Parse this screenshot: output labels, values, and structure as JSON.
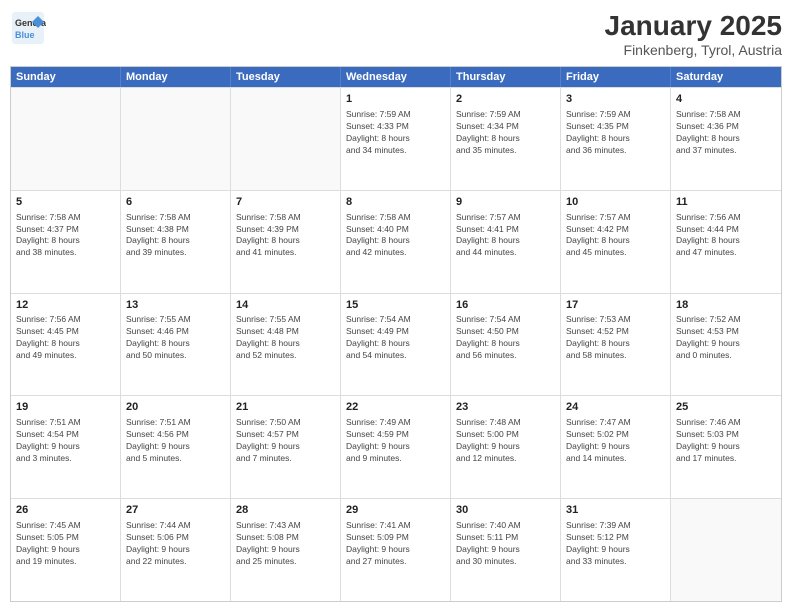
{
  "header": {
    "logo_line1": "General",
    "logo_line2": "Blue",
    "title": "January 2025",
    "subtitle": "Finkenberg, Tyrol, Austria"
  },
  "weekdays": [
    "Sunday",
    "Monday",
    "Tuesday",
    "Wednesday",
    "Thursday",
    "Friday",
    "Saturday"
  ],
  "weeks": [
    [
      {
        "day": "",
        "text": ""
      },
      {
        "day": "",
        "text": ""
      },
      {
        "day": "",
        "text": ""
      },
      {
        "day": "1",
        "text": "Sunrise: 7:59 AM\nSunset: 4:33 PM\nDaylight: 8 hours\nand 34 minutes."
      },
      {
        "day": "2",
        "text": "Sunrise: 7:59 AM\nSunset: 4:34 PM\nDaylight: 8 hours\nand 35 minutes."
      },
      {
        "day": "3",
        "text": "Sunrise: 7:59 AM\nSunset: 4:35 PM\nDaylight: 8 hours\nand 36 minutes."
      },
      {
        "day": "4",
        "text": "Sunrise: 7:58 AM\nSunset: 4:36 PM\nDaylight: 8 hours\nand 37 minutes."
      }
    ],
    [
      {
        "day": "5",
        "text": "Sunrise: 7:58 AM\nSunset: 4:37 PM\nDaylight: 8 hours\nand 38 minutes."
      },
      {
        "day": "6",
        "text": "Sunrise: 7:58 AM\nSunset: 4:38 PM\nDaylight: 8 hours\nand 39 minutes."
      },
      {
        "day": "7",
        "text": "Sunrise: 7:58 AM\nSunset: 4:39 PM\nDaylight: 8 hours\nand 41 minutes."
      },
      {
        "day": "8",
        "text": "Sunrise: 7:58 AM\nSunset: 4:40 PM\nDaylight: 8 hours\nand 42 minutes."
      },
      {
        "day": "9",
        "text": "Sunrise: 7:57 AM\nSunset: 4:41 PM\nDaylight: 8 hours\nand 44 minutes."
      },
      {
        "day": "10",
        "text": "Sunrise: 7:57 AM\nSunset: 4:42 PM\nDaylight: 8 hours\nand 45 minutes."
      },
      {
        "day": "11",
        "text": "Sunrise: 7:56 AM\nSunset: 4:44 PM\nDaylight: 8 hours\nand 47 minutes."
      }
    ],
    [
      {
        "day": "12",
        "text": "Sunrise: 7:56 AM\nSunset: 4:45 PM\nDaylight: 8 hours\nand 49 minutes."
      },
      {
        "day": "13",
        "text": "Sunrise: 7:55 AM\nSunset: 4:46 PM\nDaylight: 8 hours\nand 50 minutes."
      },
      {
        "day": "14",
        "text": "Sunrise: 7:55 AM\nSunset: 4:48 PM\nDaylight: 8 hours\nand 52 minutes."
      },
      {
        "day": "15",
        "text": "Sunrise: 7:54 AM\nSunset: 4:49 PM\nDaylight: 8 hours\nand 54 minutes."
      },
      {
        "day": "16",
        "text": "Sunrise: 7:54 AM\nSunset: 4:50 PM\nDaylight: 8 hours\nand 56 minutes."
      },
      {
        "day": "17",
        "text": "Sunrise: 7:53 AM\nSunset: 4:52 PM\nDaylight: 8 hours\nand 58 minutes."
      },
      {
        "day": "18",
        "text": "Sunrise: 7:52 AM\nSunset: 4:53 PM\nDaylight: 9 hours\nand 0 minutes."
      }
    ],
    [
      {
        "day": "19",
        "text": "Sunrise: 7:51 AM\nSunset: 4:54 PM\nDaylight: 9 hours\nand 3 minutes."
      },
      {
        "day": "20",
        "text": "Sunrise: 7:51 AM\nSunset: 4:56 PM\nDaylight: 9 hours\nand 5 minutes."
      },
      {
        "day": "21",
        "text": "Sunrise: 7:50 AM\nSunset: 4:57 PM\nDaylight: 9 hours\nand 7 minutes."
      },
      {
        "day": "22",
        "text": "Sunrise: 7:49 AM\nSunset: 4:59 PM\nDaylight: 9 hours\nand 9 minutes."
      },
      {
        "day": "23",
        "text": "Sunrise: 7:48 AM\nSunset: 5:00 PM\nDaylight: 9 hours\nand 12 minutes."
      },
      {
        "day": "24",
        "text": "Sunrise: 7:47 AM\nSunset: 5:02 PM\nDaylight: 9 hours\nand 14 minutes."
      },
      {
        "day": "25",
        "text": "Sunrise: 7:46 AM\nSunset: 5:03 PM\nDaylight: 9 hours\nand 17 minutes."
      }
    ],
    [
      {
        "day": "26",
        "text": "Sunrise: 7:45 AM\nSunset: 5:05 PM\nDaylight: 9 hours\nand 19 minutes."
      },
      {
        "day": "27",
        "text": "Sunrise: 7:44 AM\nSunset: 5:06 PM\nDaylight: 9 hours\nand 22 minutes."
      },
      {
        "day": "28",
        "text": "Sunrise: 7:43 AM\nSunset: 5:08 PM\nDaylight: 9 hours\nand 25 minutes."
      },
      {
        "day": "29",
        "text": "Sunrise: 7:41 AM\nSunset: 5:09 PM\nDaylight: 9 hours\nand 27 minutes."
      },
      {
        "day": "30",
        "text": "Sunrise: 7:40 AM\nSunset: 5:11 PM\nDaylight: 9 hours\nand 30 minutes."
      },
      {
        "day": "31",
        "text": "Sunrise: 7:39 AM\nSunset: 5:12 PM\nDaylight: 9 hours\nand 33 minutes."
      },
      {
        "day": "",
        "text": ""
      }
    ]
  ]
}
